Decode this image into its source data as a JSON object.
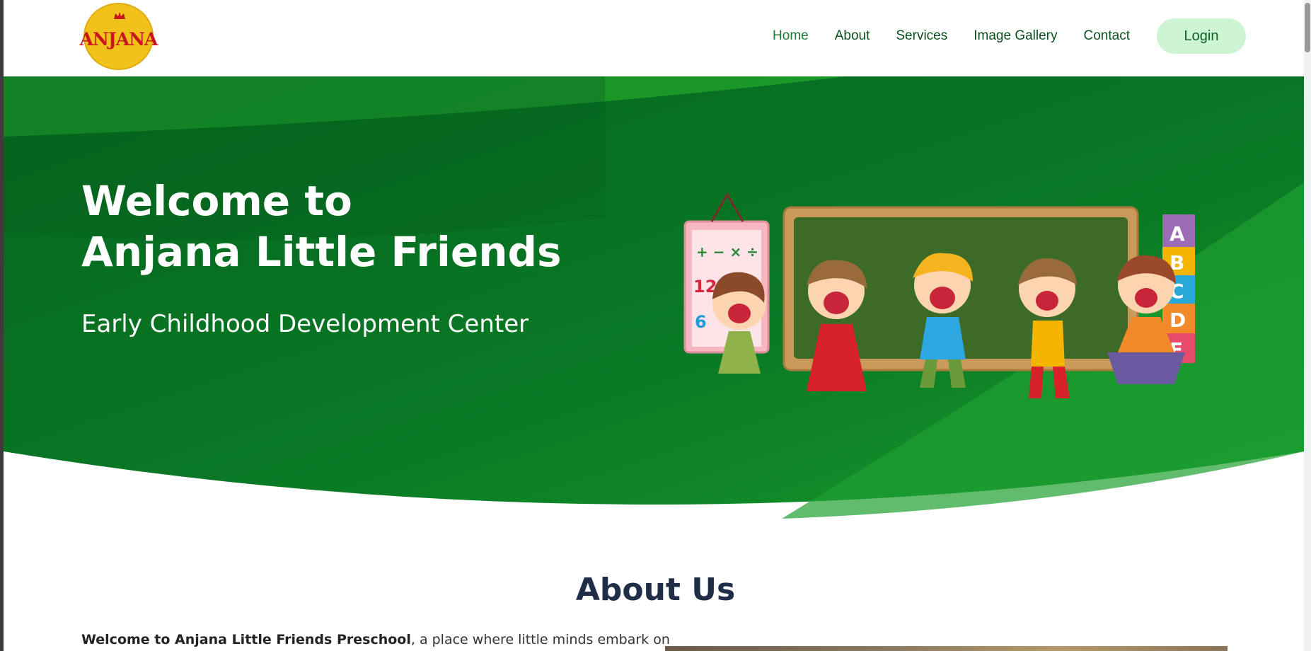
{
  "header": {
    "logo_text": "ANJANA",
    "nav": [
      {
        "label": "Home",
        "active": true
      },
      {
        "label": "About"
      },
      {
        "label": "Services"
      },
      {
        "label": "Image Gallery"
      },
      {
        "label": "Contact"
      }
    ],
    "login_label": "Login"
  },
  "hero": {
    "title_line1": "Welcome to",
    "title_line2": "Anjana Little Friends",
    "subtitle": "Early Childhood Development Center",
    "illustration": "kids-chalkboard-illustration"
  },
  "about": {
    "title": "About Us",
    "intro_bold": "Welcome to Anjana Little Friends Preschool",
    "intro_rest": ", a place where little minds embark on"
  },
  "colors": {
    "hero_dark": "#066a22",
    "hero_light": "#1ea030",
    "nav_text": "#0b4f1c",
    "login_bg": "#cdf5d3",
    "about_title": "#1f2d47"
  }
}
